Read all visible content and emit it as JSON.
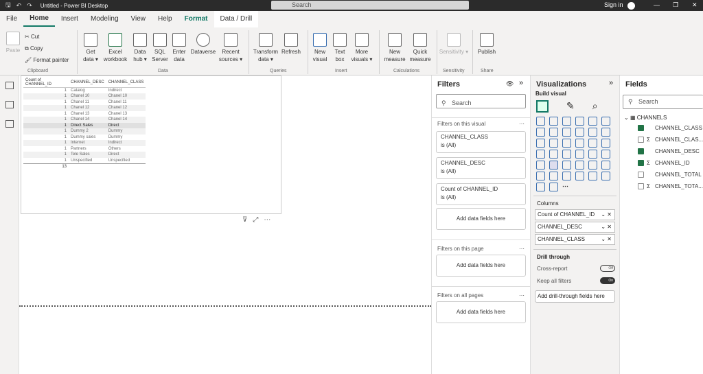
{
  "titlebar": {
    "title": "Untitled - Power BI Desktop",
    "search": "Search",
    "signin": "Sign in"
  },
  "tabs": [
    "File",
    "Home",
    "Insert",
    "Modeling",
    "View",
    "Help",
    "Format",
    "Data / Drill"
  ],
  "ribbon": {
    "clipboard": {
      "paste": "Paste",
      "cut": "Cut",
      "copy": "Copy",
      "format_painter": "Format painter",
      "group": "Clipboard"
    },
    "data": {
      "items": [
        "Get data ▾",
        "Excel workbook",
        "Data hub ▾",
        "SQL Server",
        "Enter data",
        "Dataverse",
        "Recent sources ▾"
      ],
      "group": "Data"
    },
    "queries": {
      "items": [
        "Transform data ▾",
        "Refresh"
      ],
      "group": "Queries"
    },
    "insert": {
      "items": [
        "New visual",
        "Text box",
        "More visuals ▾"
      ],
      "group": "Insert"
    },
    "calculations": {
      "items": [
        "New measure",
        "Quick measure"
      ],
      "group": "Calculations"
    },
    "sensitivity": {
      "items": [
        "Sensitivity ▾"
      ],
      "group": "Sensitivity"
    },
    "share": {
      "items": [
        "Publish"
      ],
      "group": "Share"
    }
  },
  "table": {
    "headers": [
      "Count of CHANNEL_ID",
      "CHANNEL_DESC",
      "CHANNEL_CLASS"
    ],
    "rows": [
      [
        "1",
        "Catalog",
        "Indirect"
      ],
      [
        "1",
        "Chanel 10",
        "Chanel 10"
      ],
      [
        "1",
        "Chanel 11",
        "Chanel 11"
      ],
      [
        "1",
        "Chanel 12",
        "Chanel 12"
      ],
      [
        "1",
        "Chanel 13",
        "Chanel 13"
      ],
      [
        "1",
        "Chanel 14",
        "Chanel 14"
      ],
      [
        "1",
        "Direct Sales",
        "Direct"
      ],
      [
        "1",
        "Dummy 2",
        "Dummy"
      ],
      [
        "1",
        "Dummy sales",
        "Dummy"
      ],
      [
        "1",
        "Internet",
        "Indirect"
      ],
      [
        "1",
        "Partners",
        "Others"
      ],
      [
        "1",
        "Tele Sales",
        "Direct"
      ],
      [
        "1",
        "Unspecified",
        "Unspecified"
      ]
    ],
    "total": "13"
  },
  "filters": {
    "title": "Filters",
    "search": "Search",
    "on_visual": "Filters on this visual",
    "cards": [
      {
        "field": "CHANNEL_CLASS",
        "value": "is (All)"
      },
      {
        "field": "CHANNEL_DESC",
        "value": "is (All)"
      },
      {
        "field": "Count of CHANNEL_ID",
        "value": "is (All)"
      }
    ],
    "add": "Add data fields here",
    "on_page": "Filters on this page",
    "on_all": "Filters on all pages"
  },
  "viz": {
    "title": "Visualizations",
    "build": "Build visual",
    "columns": "Columns",
    "wells": [
      "Count of CHANNEL_ID",
      "CHANNEL_DESC",
      "CHANNEL_CLASS"
    ],
    "drill": "Drill through",
    "cross": "Cross-report",
    "cross_state": "Off",
    "keep": "Keep all filters",
    "keep_state": "On",
    "add_drill": "Add drill-through fields here"
  },
  "fields": {
    "title": "Fields",
    "search": "Search",
    "table": "CHANNELS",
    "items": [
      {
        "name": "CHANNEL_CLASS",
        "checked": true,
        "sigma": false
      },
      {
        "name": "CHANNEL_CLAS...",
        "checked": false,
        "sigma": true
      },
      {
        "name": "CHANNEL_DESC",
        "checked": true,
        "sigma": false
      },
      {
        "name": "CHANNEL_ID",
        "checked": true,
        "sigma": true
      },
      {
        "name": "CHANNEL_TOTAL",
        "checked": false,
        "sigma": false
      },
      {
        "name": "CHANNEL_TOTA...",
        "checked": false,
        "sigma": true
      }
    ]
  }
}
